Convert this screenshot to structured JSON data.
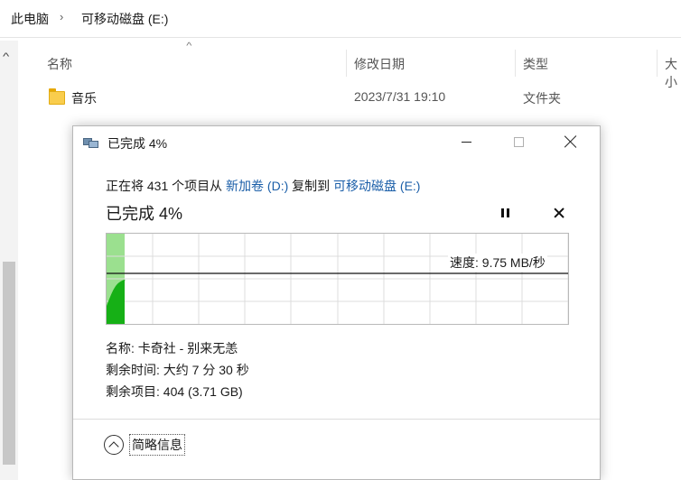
{
  "breadcrumb": {
    "items": [
      "此电脑",
      "可移动磁盘 (E:)"
    ],
    "separator": "›"
  },
  "columns": {
    "name": "名称",
    "modified": "修改日期",
    "type": "类型",
    "size": "大小"
  },
  "files": [
    {
      "name": "音乐",
      "modified": "2023/7/31 19:10",
      "type": "文件夹"
    }
  ],
  "dialog": {
    "title": "已完成 4%",
    "status": {
      "prefix": "正在将 431 个项目从 ",
      "source": "新加卷 (D:)",
      "middle": " 复制到 ",
      "destination": "可移动磁盘 (E:)"
    },
    "heading": "已完成 4%",
    "progress_percent": 4,
    "speed": "速度: 9.75 MB/秒",
    "details": {
      "name": "名称: 卡奇社 - 别来无恙",
      "time_left": "剩余时间: 大约 7 分 30 秒",
      "items_left": "剩余项目: 404 (3.71 GB)"
    },
    "less_info_label": "简略信息"
  },
  "icons": {
    "folder": "folder-icon",
    "copy": "copy-icon",
    "pause": "pause-icon",
    "cancel": "cancel-icon",
    "chevron": "chevron-up-circle-icon"
  },
  "colors": {
    "accent_link": "#1a5ea8",
    "progress_fill": "#9be08f",
    "transfer_fill": "#16b016",
    "folder": "#f9cd4d"
  }
}
